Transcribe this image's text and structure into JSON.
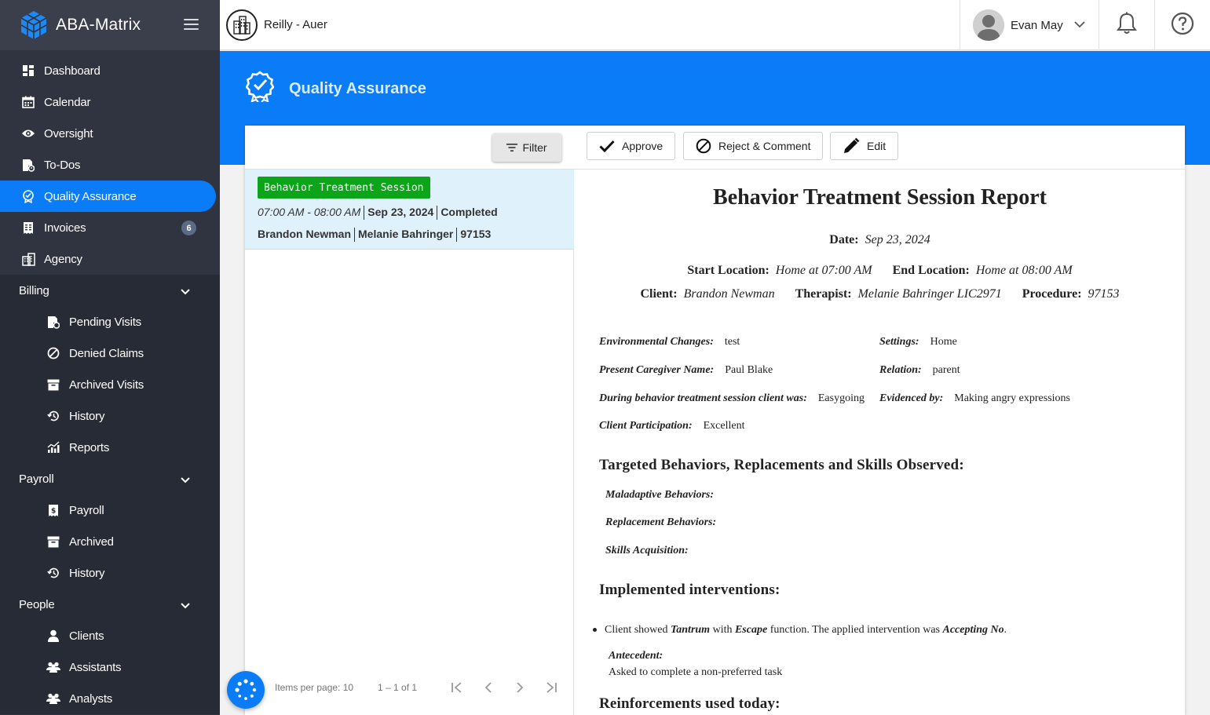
{
  "app": {
    "name": "ABA-Matrix"
  },
  "nav_top": [
    {
      "label": "Dashboard",
      "icon": "dashboard-icon"
    },
    {
      "label": "Calendar",
      "icon": "calendar-icon"
    },
    {
      "label": "Oversight",
      "icon": "eye-icon"
    },
    {
      "label": "To-Dos",
      "icon": "todo-icon"
    },
    {
      "label": "Quality Assurance",
      "icon": "badge-check-icon",
      "active": true
    },
    {
      "label": "Invoices",
      "icon": "invoice-icon",
      "badge": "6"
    },
    {
      "label": "Agency",
      "icon": "building-icon"
    }
  ],
  "sections": {
    "billing": {
      "label": "Billing",
      "items": [
        "Pending Visits",
        "Denied Claims",
        "Archived Visits",
        "History",
        "Reports"
      ]
    },
    "payroll": {
      "label": "Payroll",
      "items": [
        "Payroll",
        "Archived",
        "History"
      ]
    },
    "people": {
      "label": "People",
      "items": [
        "Clients",
        "Assistants",
        "Analysts"
      ]
    }
  },
  "topbar": {
    "agency": "Reilly - Auer",
    "user": "Evan May"
  },
  "page": {
    "title": "Quality Assurance"
  },
  "toolbar": {
    "filter": "Filter",
    "approve": "Approve",
    "reject": "Reject & Comment",
    "edit": "Edit"
  },
  "session": {
    "tag": "Behavior Treatment Session",
    "time": "07:00 AM - 08:00 AM",
    "date": "Sep 23, 2024",
    "status": "Completed",
    "client": "Brandon Newman",
    "therapist": "Melanie Bahringer",
    "code": "97153"
  },
  "pager": {
    "items_per_page": "Items per page:  10",
    "range": "1 – 1 of 1"
  },
  "report": {
    "title": "Behavior Treatment Session Report",
    "date_label": "Date:",
    "date": "Sep 23, 2024",
    "start_label": "Start Location:",
    "start": "Home at 07:00 AM",
    "end_label": "End Location:",
    "end": "Home at 08:00 AM",
    "client_label": "Client:",
    "client": "Brandon Newman",
    "therapist_label": "Therapist:",
    "therapist": "Melanie Bahringer LIC2971",
    "procedure_label": "Procedure:",
    "procedure": "97153",
    "env_label": "Environmental Changes:",
    "env": "test",
    "settings_label": "Settings:",
    "settings": "Home",
    "caregiver_label": "Present Caregiver Name:",
    "caregiver": "Paul Blake",
    "relation_label": "Relation:",
    "relation": "parent",
    "during_label": "During behavior treatment session client was:",
    "during": "Easygoing",
    "evidenced_label": "Evidenced by:",
    "evidenced": "Making angry expressions",
    "participation_label": "Client Participation:",
    "participation": "Excellent",
    "h_targeted": "Targeted Behaviors, Replacements and Skills Observed:",
    "maladaptive": "Maladaptive Behaviors:",
    "replacement": "Replacement Behaviors:",
    "skills": "Skills Acquisition:",
    "h_interventions": "Implemented interventions:",
    "bullet_a": "Client showed ",
    "bullet_behavior": "Tantrum",
    "bullet_b": " with ",
    "bullet_function": "Escape",
    "bullet_c": " function. The applied intervention was ",
    "bullet_intervention": "Accepting No",
    "bullet_d": ".",
    "antecedent_label": "Antecedent:",
    "antecedent": "Asked to complete a non-preferred task",
    "h_reinforcements": "Reinforcements used today:"
  },
  "colors": {
    "primary": "#0a7cf8",
    "sidebar": "#2f3440",
    "tag_green": "#0ca51a",
    "selected_row": "#dff1fb"
  }
}
